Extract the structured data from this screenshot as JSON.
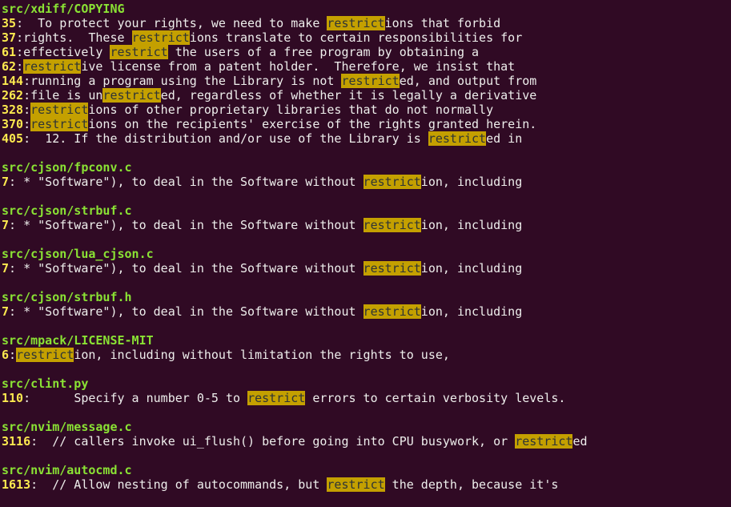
{
  "colors": {
    "background": "#300a24",
    "filename": "#8ae234",
    "line_number": "#fce94f",
    "match_bg": "#c4a000",
    "text": "#eeeeec"
  },
  "results": [
    {
      "file": "src/xdiff/COPYING",
      "lines": [
        {
          "num": "35",
          "sep": ":  ",
          "pre": "To protect your rights, we need to make ",
          "match": "restrict",
          "post": "ions that forbid"
        },
        {
          "num": "37",
          "sep": ":",
          "pre": "rights.  These ",
          "match": "restrict",
          "post": "ions translate to certain responsibilities for"
        },
        {
          "num": "61",
          "sep": ":",
          "pre": "effectively ",
          "match": "restrict",
          "post": " the users of a free program by obtaining a"
        },
        {
          "num": "62",
          "sep": ":",
          "pre": "",
          "match": "restrict",
          "post": "ive license from a patent holder.  Therefore, we insist that"
        },
        {
          "num": "144",
          "sep": ":",
          "pre": "running a program using the Library is not ",
          "match": "restrict",
          "post": "ed, and output from"
        },
        {
          "num": "262",
          "sep": ":",
          "pre": "file is un",
          "match": "restrict",
          "post": "ed, regardless of whether it is legally a derivative"
        },
        {
          "num": "328",
          "sep": ":",
          "pre": "",
          "match": "restrict",
          "post": "ions of other proprietary libraries that do not normally"
        },
        {
          "num": "370",
          "sep": ":",
          "pre": "",
          "match": "restrict",
          "post": "ions on the recipients' exercise of the rights granted herein."
        },
        {
          "num": "405",
          "sep": ":  ",
          "pre": "12. If the distribution and/or use of the Library is ",
          "match": "restrict",
          "post": "ed in"
        }
      ]
    },
    {
      "file": "src/cjson/fpconv.c",
      "lines": [
        {
          "num": "7",
          "sep": ": ",
          "pre": "* \"Software\"), to deal in the Software without ",
          "match": "restrict",
          "post": "ion, including"
        }
      ]
    },
    {
      "file": "src/cjson/strbuf.c",
      "lines": [
        {
          "num": "7",
          "sep": ": ",
          "pre": "* \"Software\"), to deal in the Software without ",
          "match": "restrict",
          "post": "ion, including"
        }
      ]
    },
    {
      "file": "src/cjson/lua_cjson.c",
      "lines": [
        {
          "num": "7",
          "sep": ": ",
          "pre": "* \"Software\"), to deal in the Software without ",
          "match": "restrict",
          "post": "ion, including"
        }
      ]
    },
    {
      "file": "src/cjson/strbuf.h",
      "lines": [
        {
          "num": "7",
          "sep": ": ",
          "pre": "* \"Software\"), to deal in the Software without ",
          "match": "restrict",
          "post": "ion, including"
        }
      ]
    },
    {
      "file": "src/mpack/LICENSE-MIT",
      "lines": [
        {
          "num": "6",
          "sep": ":",
          "pre": "",
          "match": "restrict",
          "post": "ion, including without limitation the rights to use,"
        }
      ]
    },
    {
      "file": "src/clint.py",
      "lines": [
        {
          "num": "110",
          "sep": ":      ",
          "pre": "Specify a number 0-5 to ",
          "match": "restrict",
          "post": " errors to certain verbosity levels."
        }
      ]
    },
    {
      "file": "src/nvim/message.c",
      "lines": [
        {
          "num": "3116",
          "sep": ":  ",
          "pre": "// callers invoke ui_flush() before going into CPU busywork, or ",
          "match": "restrict",
          "post": "ed"
        }
      ]
    },
    {
      "file": "src/nvim/autocmd.c",
      "lines": [
        {
          "num": "1613",
          "sep": ":  ",
          "pre": "// Allow nesting of autocommands, but ",
          "match": "restrict",
          "post": " the depth, because it's"
        }
      ]
    }
  ]
}
